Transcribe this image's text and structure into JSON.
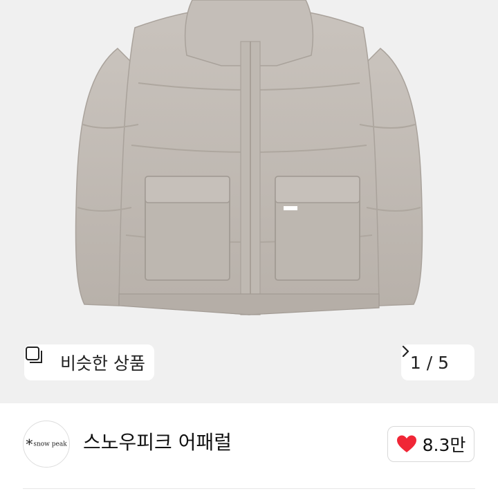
{
  "gallery": {
    "similar_label": "비슷한 상품",
    "similar_icon": "copy-icon",
    "page_counter": "1 / 5",
    "next_icon": "chevron-right-icon"
  },
  "seller": {
    "logo_text": "snow peak",
    "name": "스노우피크 어패럴"
  },
  "like": {
    "icon": "heart-icon",
    "count": "8.3만",
    "color": "#f02636"
  }
}
